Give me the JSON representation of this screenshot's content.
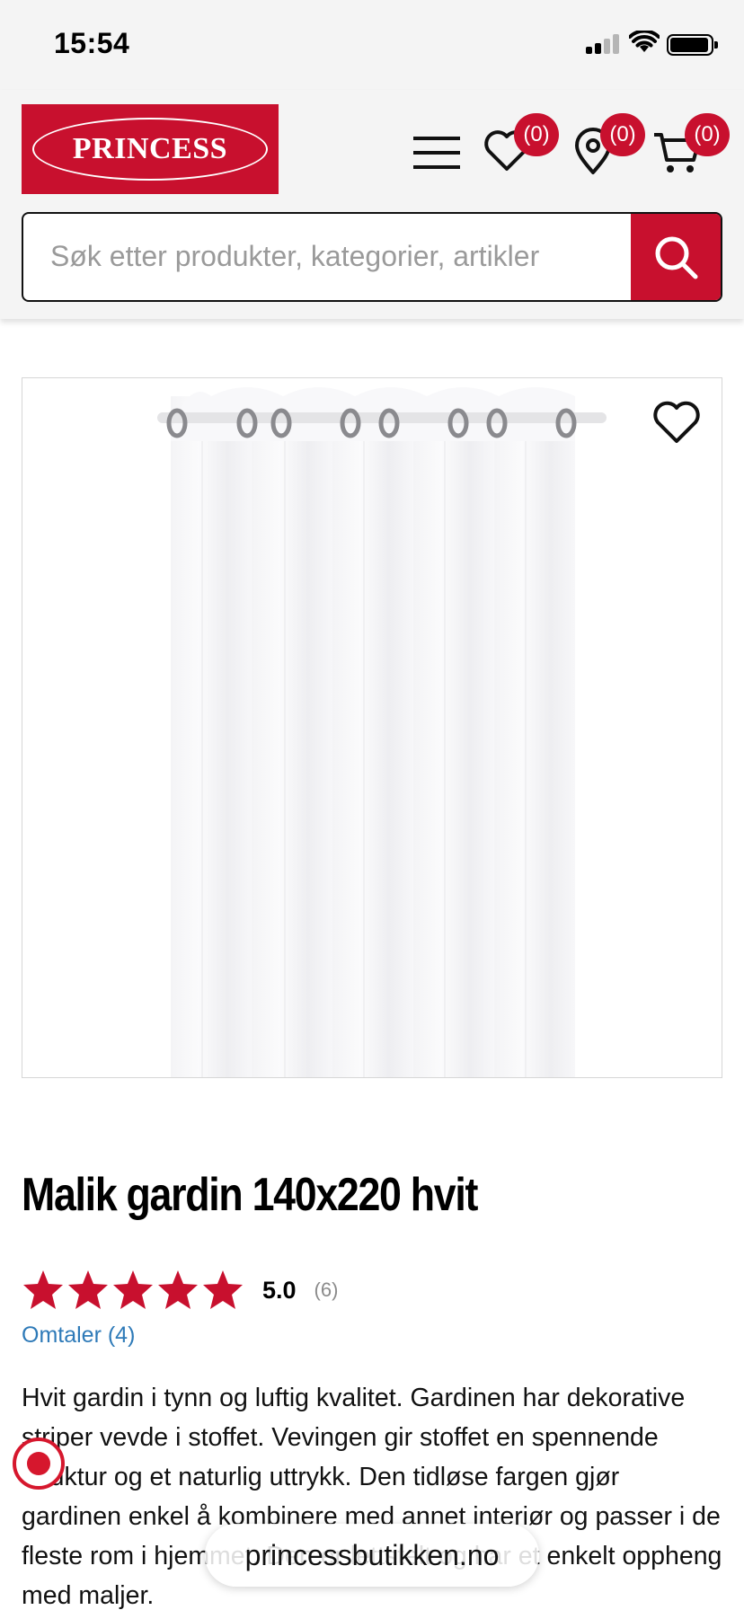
{
  "status_bar": {
    "time": "15:54"
  },
  "brand": {
    "name": "PRINCESS",
    "accent": "#c8102e"
  },
  "header": {
    "wishlist_count": "(0)",
    "stores_count": "(0)",
    "cart_count": "(0)"
  },
  "search": {
    "placeholder": "Søk etter produkter, kategorier, artikler"
  },
  "product": {
    "title": "Malik gardin 140x220 hvit",
    "rating_value": "5.0",
    "rating_stars": 5,
    "rating_count": "(6)",
    "reviews_link": "Omtaler (4)",
    "description": "Hvit gardin i tynn og luftig kvalitet. Gardinen har dekorative striper vevde i stoffet. Vevingen gir stoffet en spennende struktur og et naturlig uttrykk. Den tidløse fargen gjør gardinen enkel å kombinere med annet interiør og passer i de fleste rom i hjemmet. Den er lettstelt og har et enkelt oppheng med maljer."
  },
  "browser": {
    "url": "princessbutikken.no"
  }
}
